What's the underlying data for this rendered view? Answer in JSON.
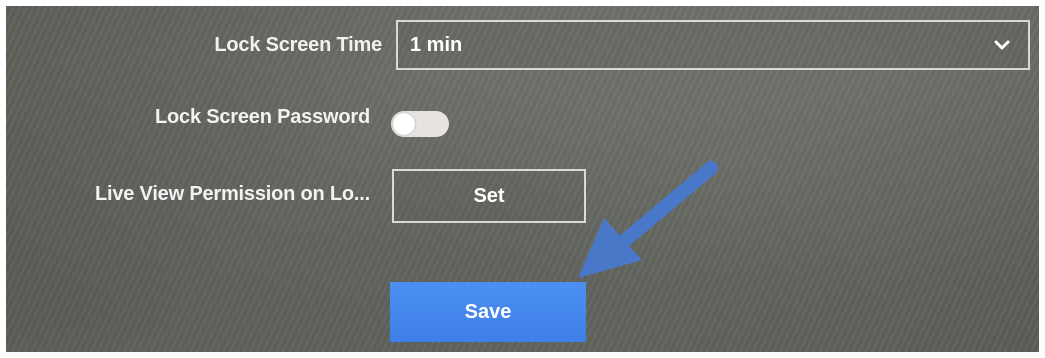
{
  "form": {
    "lock_screen_time": {
      "label": "Lock Screen Time",
      "value": "1 min"
    },
    "lock_screen_password": {
      "label": "Lock Screen Password",
      "enabled": false
    },
    "live_view_permission": {
      "label": "Live View Permission on Lo...",
      "button_label": "Set"
    },
    "save_label": "Save"
  },
  "icons": {
    "dropdown": "chevron-down-icon",
    "annotation": "arrow-icon"
  },
  "colors": {
    "save_button": "#4088ee",
    "annotation_arrow": "#4a78c8",
    "background": "#63655f"
  }
}
